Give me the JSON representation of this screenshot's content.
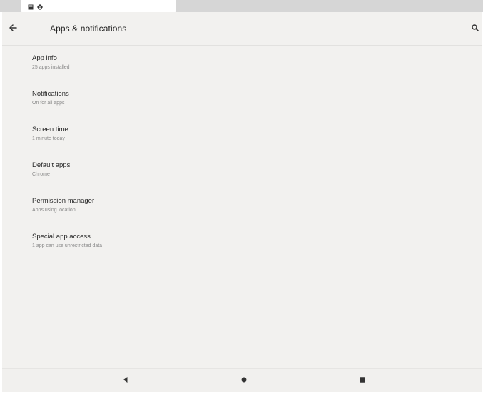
{
  "status_bar": {
    "icons": [
      "image-icon",
      "gear-icon"
    ]
  },
  "toolbar": {
    "title": "Apps & notifications",
    "back_icon": "arrow-left-icon",
    "search_icon": "search-icon"
  },
  "settings": {
    "items": [
      {
        "title": "App info",
        "summary": "25 apps installed"
      },
      {
        "title": "Notifications",
        "summary": "On for all apps"
      },
      {
        "title": "Screen time",
        "summary": "1 minute today"
      },
      {
        "title": "Default apps",
        "summary": "Chrome"
      },
      {
        "title": "Permission manager",
        "summary": "Apps using location"
      },
      {
        "title": "Special app access",
        "summary": "1 app can use unrestricted data"
      }
    ]
  },
  "nav_bar": {
    "icons": [
      "back-triangle-icon",
      "home-circle-icon",
      "recents-square-icon"
    ]
  },
  "colors": {
    "background": "#f2f1ef",
    "status_bar": "#d6d6d6",
    "text_primary": "#262626",
    "text_secondary": "#8a8a8a"
  }
}
